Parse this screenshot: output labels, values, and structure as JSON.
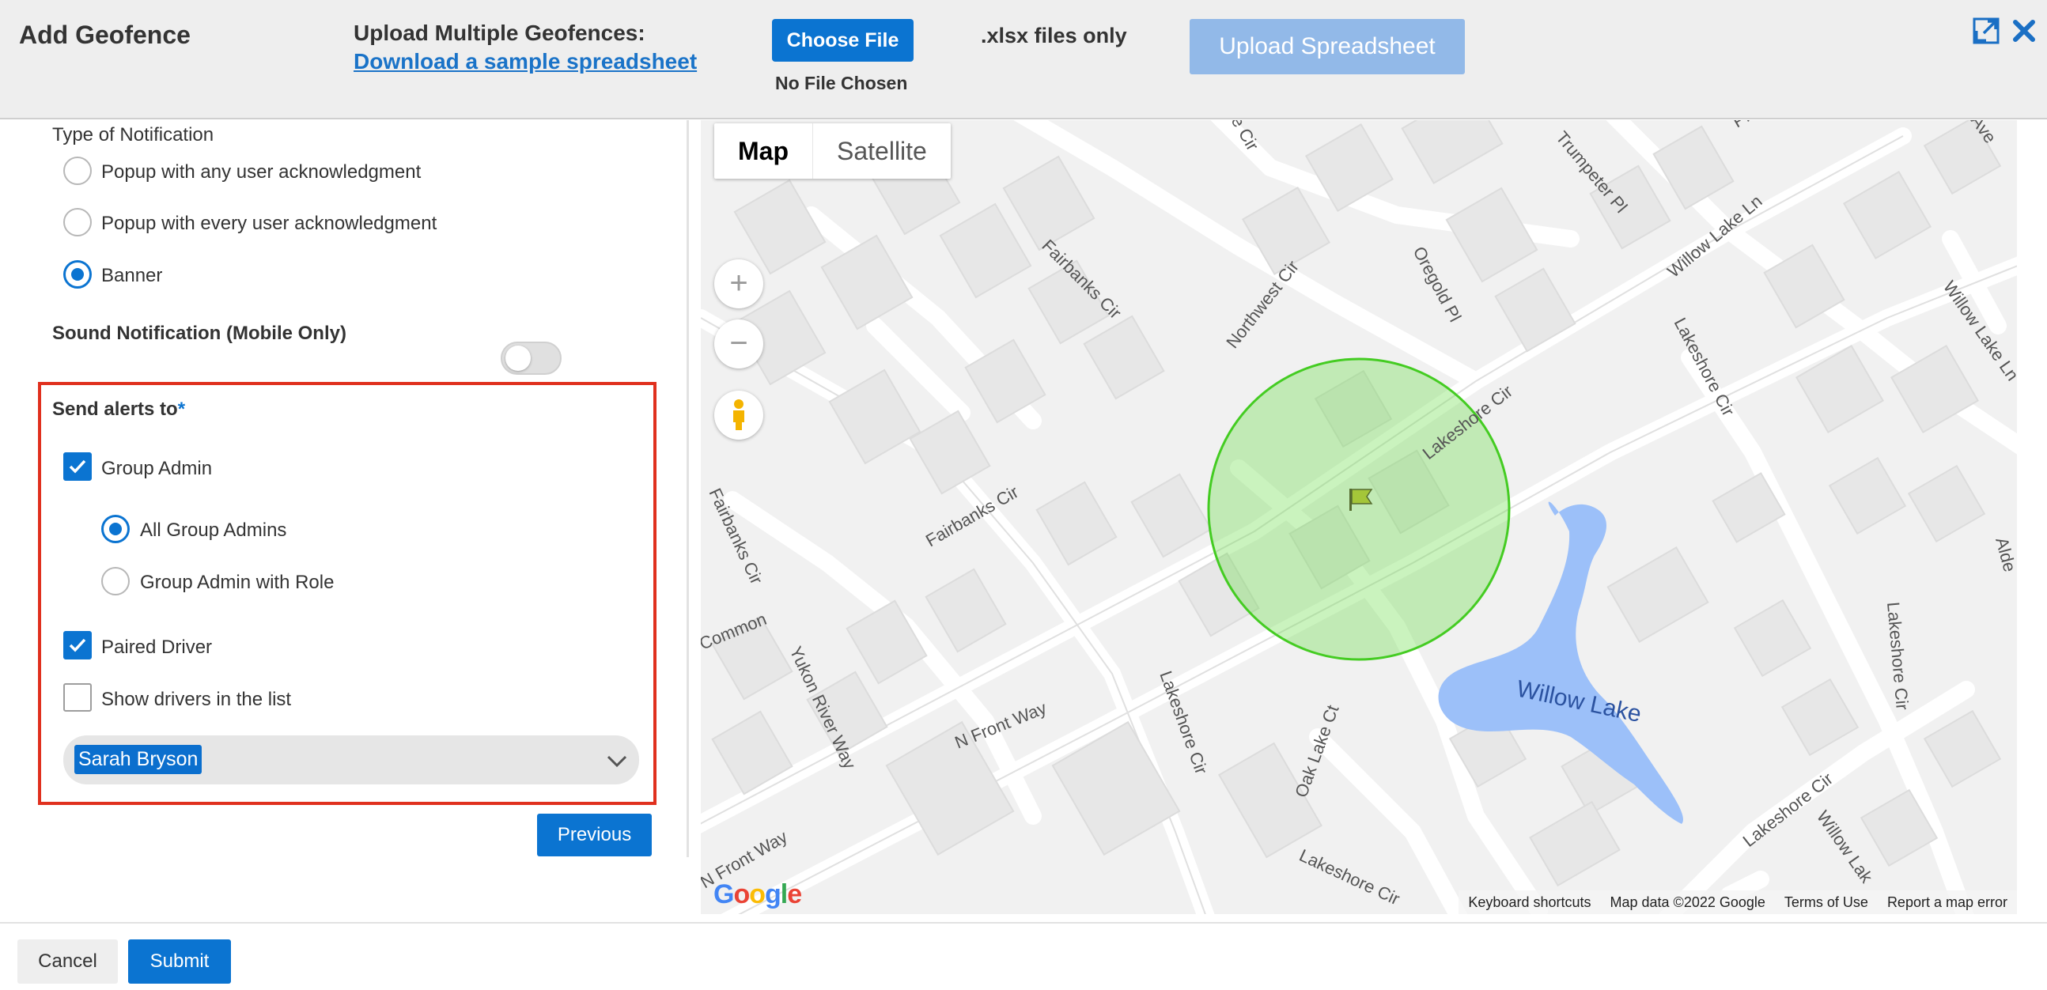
{
  "header": {
    "title": "Add Geofence",
    "upload_label": "Upload Multiple Geofences:",
    "sample_link": "Download a sample spreadsheet",
    "choose_file": "Choose File",
    "no_file": "No File Chosen",
    "file_hint": ".xlsx files only",
    "upload_button": "Upload Spreadsheet",
    "icons": [
      "expand-icon",
      "close-icon"
    ]
  },
  "form": {
    "notification_type_label": "Type of Notification",
    "notification_options": [
      {
        "label": "Popup with any user acknowledgment",
        "selected": false
      },
      {
        "label": "Popup with every user acknowledgment",
        "selected": false
      },
      {
        "label": "Banner",
        "selected": true
      }
    ],
    "sound_label": "Sound Notification (Mobile Only)",
    "sound_enabled": false,
    "send_alerts_label": "Send alerts to",
    "required_mark": "*",
    "group_admin": {
      "label": "Group Admin",
      "checked": true
    },
    "admin_options": [
      {
        "label": "All Group Admins",
        "selected": true
      },
      {
        "label": "Group Admin with Role",
        "selected": false
      }
    ],
    "paired_driver": {
      "label": "Paired Driver",
      "checked": true
    },
    "show_drivers": {
      "label": "Show drivers in the list",
      "checked": false
    },
    "driver_select_value": "Sarah Bryson",
    "previous_button": "Previous"
  },
  "map": {
    "type_map": "Map",
    "type_satellite": "Satellite",
    "zoom_in": "+",
    "zoom_out": "−",
    "logo": "Google",
    "footer": {
      "shortcuts": "Keyboard shortcuts",
      "data": "Map data ©2022 Google",
      "terms": "Terms of Use",
      "report": "Report a map error"
    },
    "labels": {
      "fairbanks_cir_1": "Fairbanks Cir",
      "fairbanks_cir_2": "Fairbanks Cir",
      "fairbanks_cir_3": "Fairbanks Cir",
      "northwest_cir": "Northwest Cir",
      "oregold_pl": "Oregold Pl",
      "trumpeter_pl": "Trumpeter Pl",
      "willow_lake_ln_1": "Willow Lake Ln",
      "willow_lake_ln_2": "Willow Lake Ln",
      "lakeshore_cir_1": "Lakeshore Cir",
      "lakeshore_cir_2": "Lakeshore Cir",
      "lakeshore_cir_3": "Lakeshore Cir",
      "lakeshore_cir_4": "Lakeshore Cir",
      "lakeshore_cir_5": "Lakeshore Cir",
      "lakeshore_cir_6": "Lakeshore Cir",
      "willow_lake": "Willow Lake",
      "yukon_river_way": "Yukon River Way",
      "n_front_way_1": "N Front Way",
      "n_front_way_2": "N Front Way",
      "oak_lake_ct": "Oak Lake Ct",
      "common": "Common",
      "willow_lak": "Willow Lak",
      "alder": "Alde",
      "ave": "Ave",
      "pl": "Pl",
      "e_cir": "e Cir"
    },
    "geofence_color": "#66dd44"
  },
  "footer": {
    "cancel": "Cancel",
    "submit": "Submit"
  },
  "colors": {
    "primary": "#0b74d1",
    "highlight_border": "#e0301e",
    "water": "#9cc0f9"
  }
}
